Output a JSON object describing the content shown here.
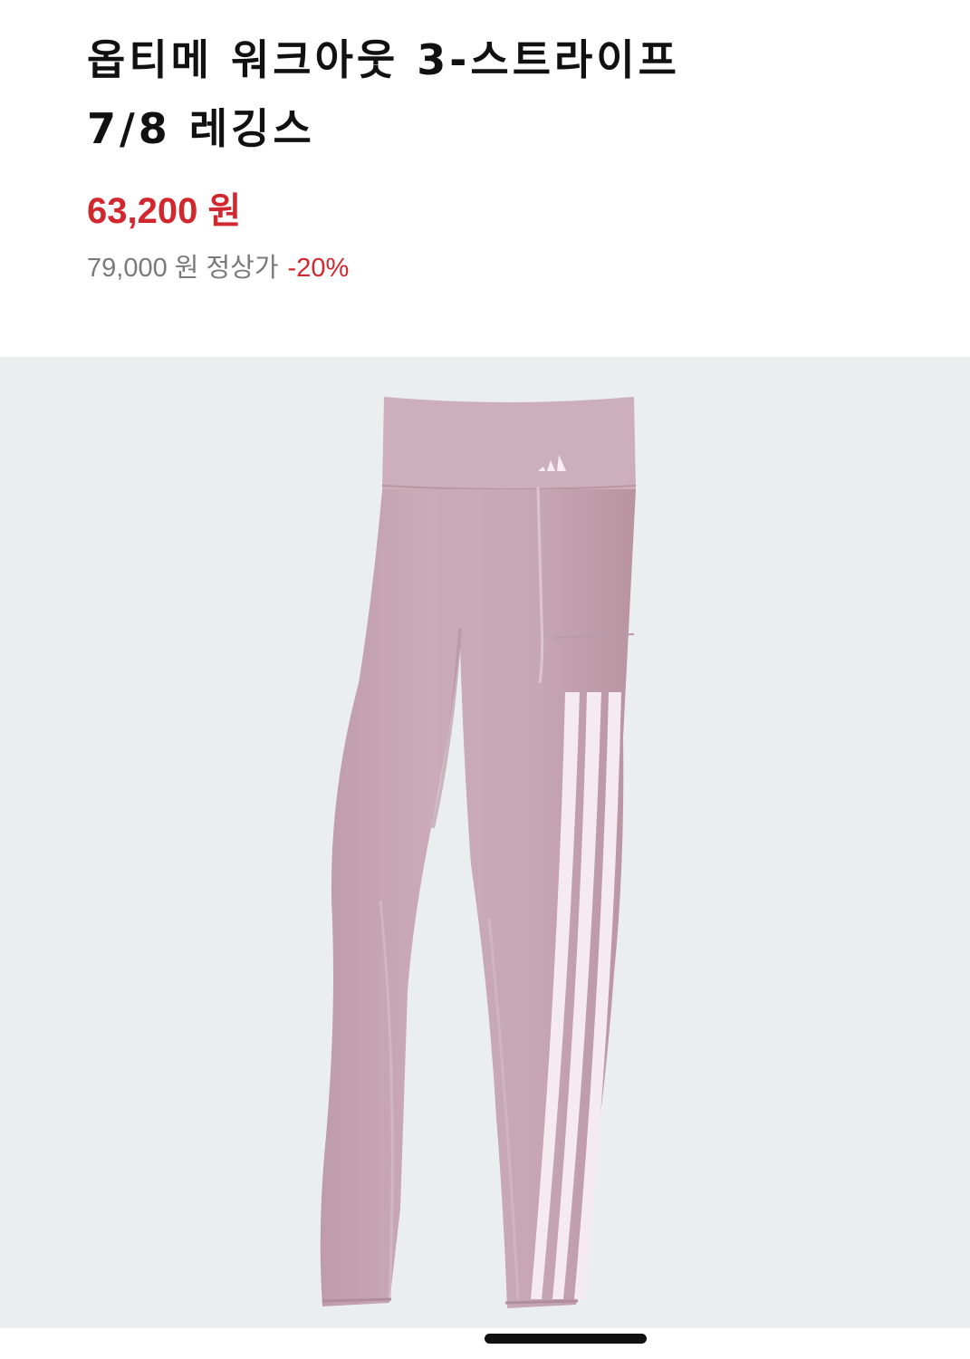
{
  "product": {
    "title_line1": "옵티메 워크아웃 3-스트라이프",
    "title_line2": "7/8 레깅스",
    "sale_price": "63,200 원",
    "original_price": "79,000 원 정상가",
    "discount": "-20%"
  },
  "image": {
    "subject": "pink-leggings-with-three-white-stripes",
    "logo": "adidas-performance-logo",
    "background_color": "#eaeeee",
    "garment_color": "#c8a8b6",
    "stripe_color": "#f4eaf0"
  },
  "colors": {
    "sale_price": "#d1282f",
    "original_price": "#7a7a7a",
    "title": "#111111"
  }
}
